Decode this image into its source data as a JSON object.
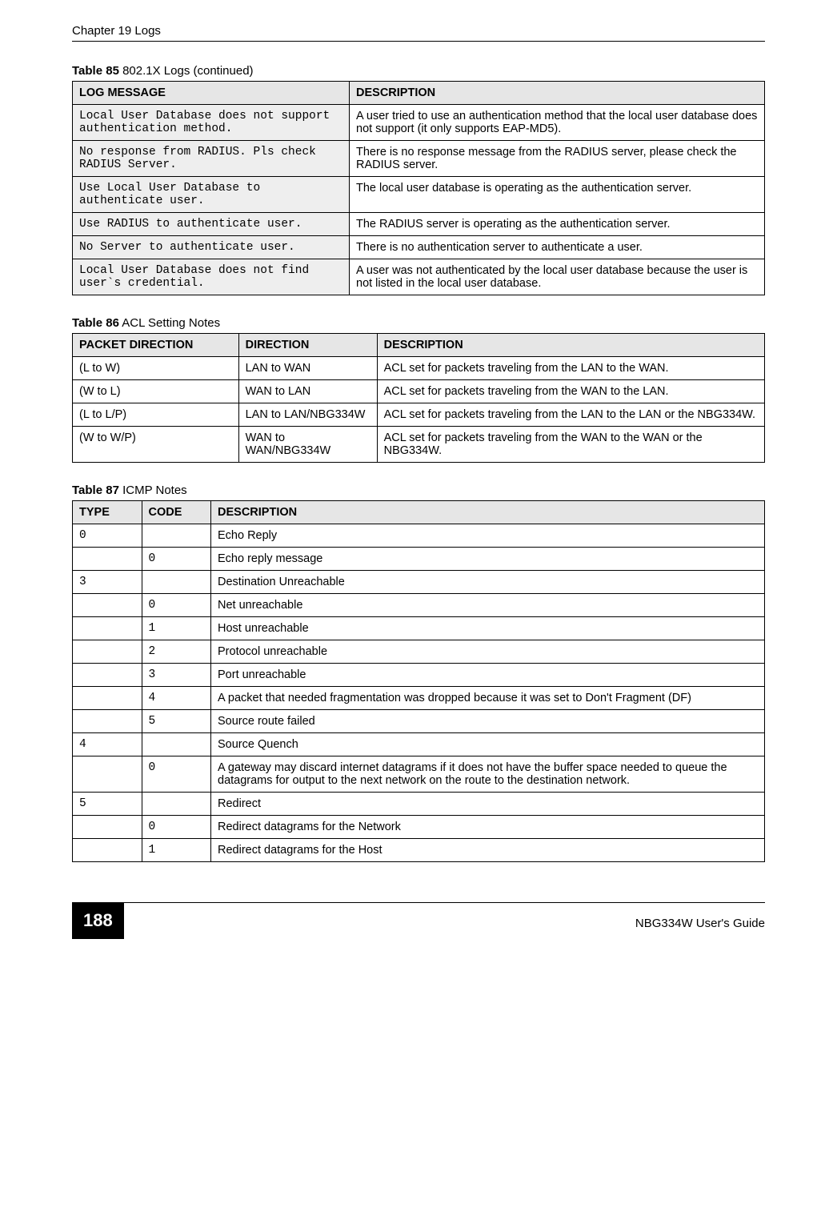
{
  "header": {
    "left": "Chapter 19 Logs",
    "right": ""
  },
  "footer": {
    "page": "188",
    "guide": "NBG334W User's Guide"
  },
  "table85": {
    "caption_bold": "Table 85",
    "caption_rest": "   802.1X Logs (continued)",
    "headers": {
      "c1": "LOG MESSAGE",
      "c2": "DESCRIPTION"
    },
    "rows": [
      {
        "msg": "Local User Database does not support authentication method.",
        "desc": "A user tried to use an authentication method that the local user database does not support (it only supports EAP-MD5)."
      },
      {
        "msg": "No response from RADIUS. Pls check RADIUS Server.",
        "desc": "There is no response message from the RADIUS server, please check the RADIUS server."
      },
      {
        "msg": "Use Local User Database to authenticate user.",
        "desc": "The local user database is operating as the authentication server."
      },
      {
        "msg": "Use RADIUS to authenticate user.",
        "desc": "The RADIUS server is operating as the authentication server."
      },
      {
        "msg": "No Server to authenticate user.",
        "desc": "There is no authentication server to authenticate a user."
      },
      {
        "msg": "Local User Database does not find user`s credential.",
        "desc": "A user was not authenticated by the local user database because the user is not listed in the local user database."
      }
    ]
  },
  "table86": {
    "caption_bold": "Table 86",
    "caption_rest": "   ACL Setting Notes",
    "headers": {
      "c1": "PACKET DIRECTION",
      "c2": "DIRECTION",
      "c3": "DESCRIPTION"
    },
    "rows": [
      {
        "pd": "(L to W)",
        "dir": "LAN to WAN",
        "desc": "ACL set for packets traveling from the LAN to the WAN."
      },
      {
        "pd": "(W to L)",
        "dir": "WAN to LAN",
        "desc": "ACL set for packets traveling from the WAN to the LAN."
      },
      {
        "pd": "(L to L/P)",
        "dir": "LAN to LAN/NBG334W",
        "desc": "ACL set for packets traveling from the LAN to the LAN or the NBG334W."
      },
      {
        "pd": "(W to W/P)",
        "dir": "WAN to WAN/NBG334W",
        "desc": "ACL set for packets traveling from the WAN to the WAN or the NBG334W."
      }
    ]
  },
  "table87": {
    "caption_bold": "Table 87",
    "caption_rest": "   ICMP Notes",
    "headers": {
      "c1": "TYPE",
      "c2": "CODE",
      "c3": "DESCRIPTION"
    },
    "rows": [
      {
        "type": "0",
        "code": "",
        "desc": "Echo Reply"
      },
      {
        "type": "",
        "code": "0",
        "desc": "Echo reply message"
      },
      {
        "type": "3",
        "code": "",
        "desc": "Destination Unreachable"
      },
      {
        "type": "",
        "code": "0",
        "desc": "Net unreachable"
      },
      {
        "type": "",
        "code": "1",
        "desc": "Host unreachable"
      },
      {
        "type": "",
        "code": "2",
        "desc": "Protocol unreachable"
      },
      {
        "type": "",
        "code": "3",
        "desc": "Port unreachable"
      },
      {
        "type": "",
        "code": "4",
        "desc": "A packet that needed fragmentation was dropped because it was set to Don't Fragment (DF)"
      },
      {
        "type": "",
        "code": "5",
        "desc": "Source route failed"
      },
      {
        "type": "4",
        "code": "",
        "desc": "Source Quench"
      },
      {
        "type": "",
        "code": "0",
        "desc": "A gateway may discard internet datagrams if it does not have the buffer space needed to queue the datagrams for output to the next network on the route to the destination network."
      },
      {
        "type": "5",
        "code": "",
        "desc": "Redirect"
      },
      {
        "type": "",
        "code": "0",
        "desc": "Redirect datagrams for the Network"
      },
      {
        "type": "",
        "code": "1",
        "desc": "Redirect datagrams for the Host"
      }
    ]
  }
}
